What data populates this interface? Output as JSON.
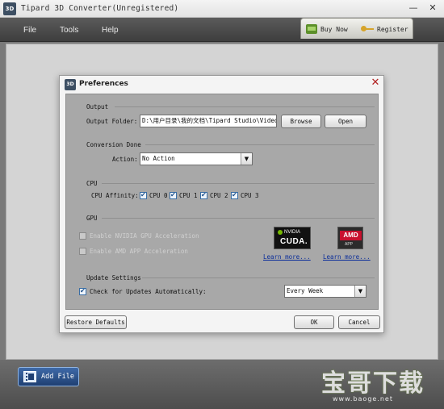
{
  "app": {
    "title": "Tipard 3D Converter(Unregistered)",
    "logo_text": "3D",
    "minimize": "—",
    "close": "✕"
  },
  "menu": {
    "items": [
      "File",
      "Tools",
      "Help"
    ]
  },
  "purchase": {
    "buy_now": "Buy Now",
    "register": "Register"
  },
  "bottom": {
    "add_file": "Add File"
  },
  "watermark": {
    "main": "宝哥下载",
    "url": "www.baoge.net"
  },
  "dialog": {
    "title": "Preferences",
    "logo_text": "3D",
    "close": "✕",
    "output": {
      "section": "Output",
      "folder_label": "Output Folder:",
      "folder_value": "D:\\用户目录\\我的文档\\Tipard Studio\\Video",
      "browse": "Browse",
      "open": "Open"
    },
    "conversion_done": {
      "section": "Conversion Done",
      "action_label": "Action:",
      "action_value": "No Action",
      "arrow": "▼"
    },
    "cpu": {
      "section": "CPU",
      "affinity_label": "CPU Affinity:",
      "cores": [
        {
          "label": "CPU 0",
          "checked": true
        },
        {
          "label": "CPU 1",
          "checked": true
        },
        {
          "label": "CPU 2",
          "checked": true
        },
        {
          "label": "CPU 3",
          "checked": true
        }
      ]
    },
    "gpu": {
      "section": "GPU",
      "nvidia_label": "Enable NVIDIA GPU Acceleration",
      "amd_label": "Enable AMD APP Acceleration",
      "nvidia_checked": false,
      "amd_checked": false,
      "nvidia_logo_top": "NVIDIA",
      "nvidia_logo_main": "CUDA.",
      "amd_logo_main": "AMD",
      "amd_logo_sub": "APP",
      "learn_more_nvidia": "Learn more...",
      "learn_more_amd": "Learn more..."
    },
    "update": {
      "section": "Update Settings",
      "check_label": "Check for Updates Automatically:",
      "checked": true,
      "frequency": "Every Week",
      "arrow": "▼"
    },
    "buttons": {
      "restore": "Restore Defaults",
      "ok": "OK",
      "cancel": "Cancel"
    }
  }
}
